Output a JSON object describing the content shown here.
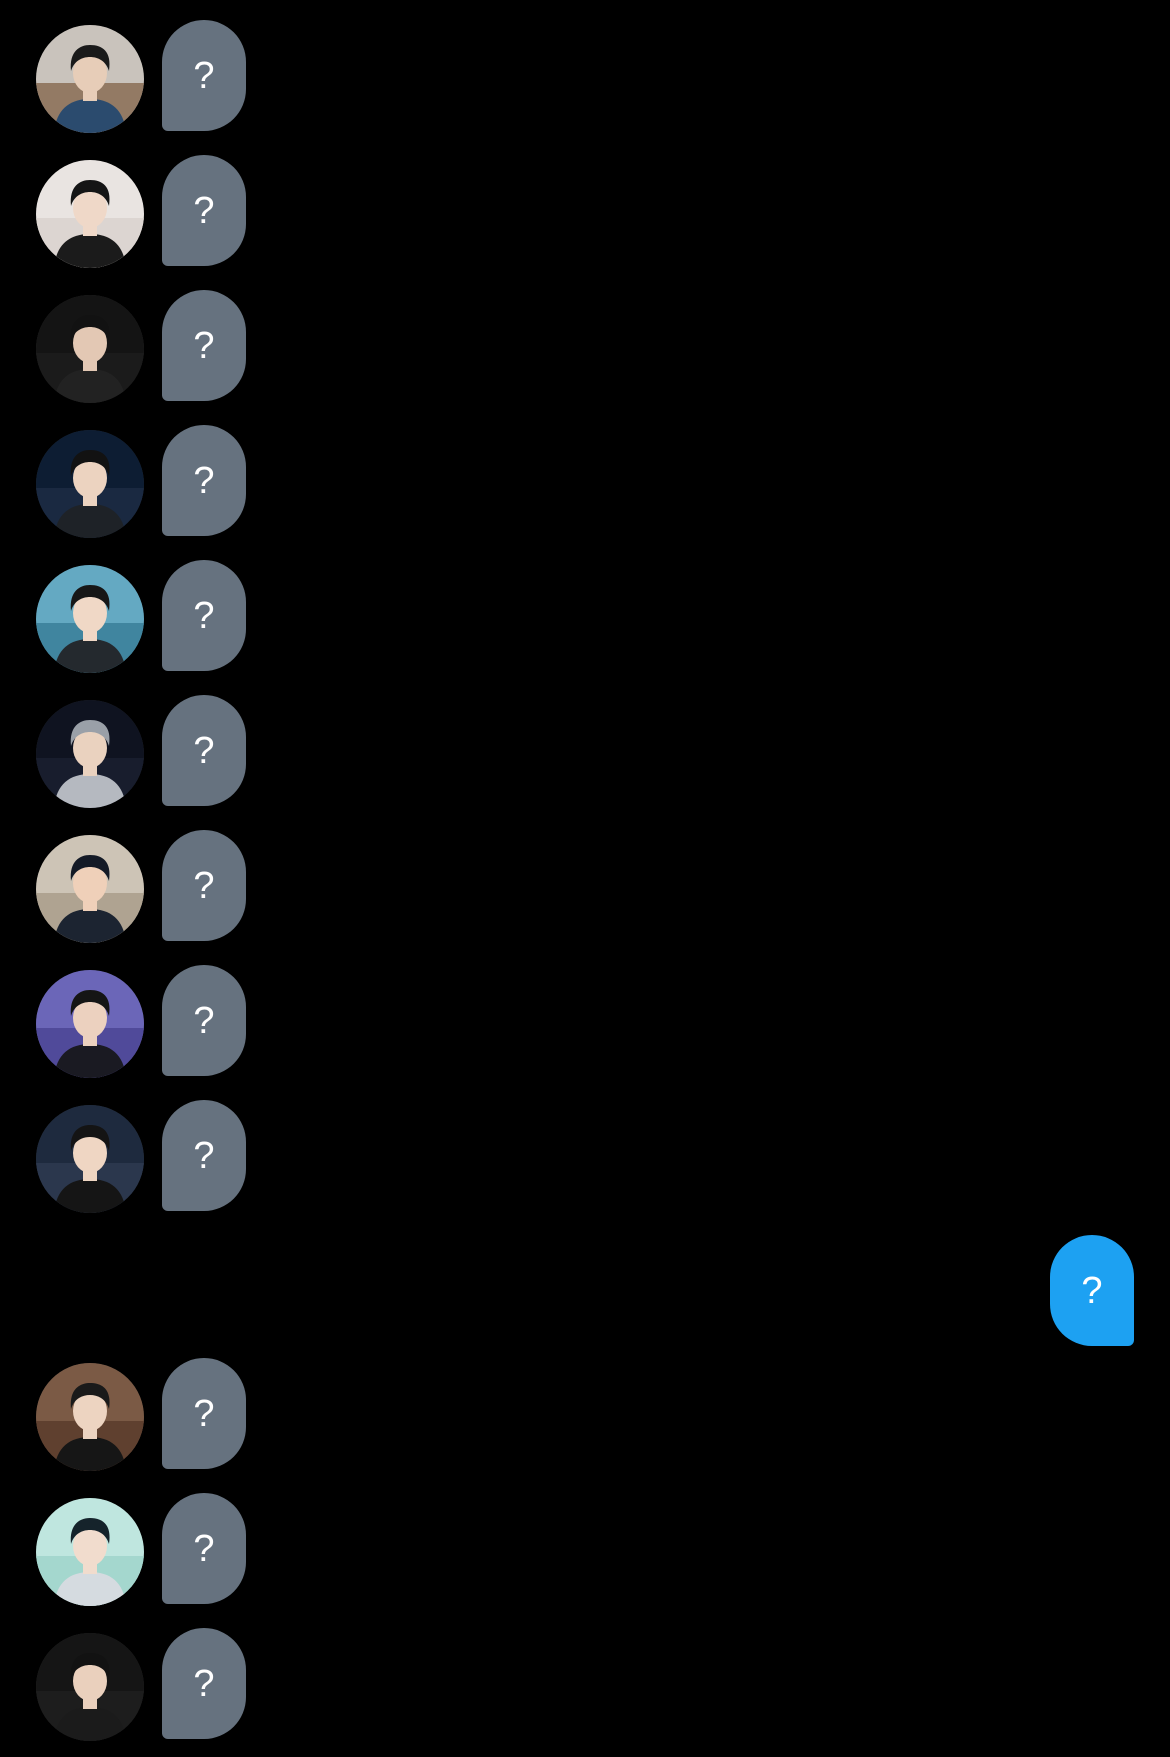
{
  "colors": {
    "background": "#000000",
    "incoming_bubble": "#66727f",
    "outgoing_bubble": "#1da1f2",
    "bubble_text": "#ffffff"
  },
  "messages": [
    {
      "direction": "incoming",
      "text": "?",
      "avatar": {
        "sky": "#c9c3bc",
        "bg": "#8a6d55",
        "shirt": "#2b4b6e",
        "hair": "#1a1a1a",
        "skin": "#e7cdb8"
      }
    },
    {
      "direction": "incoming",
      "text": "?",
      "avatar": {
        "sky": "#e9e4e1",
        "bg": "#d9d2ce",
        "shirt": "#1b1b1b",
        "hair": "#151515",
        "skin": "#efd8c8"
      }
    },
    {
      "direction": "incoming",
      "text": "?",
      "avatar": {
        "sky": "#141414",
        "bg": "#1c1c1c",
        "shirt": "#222222",
        "hair": "#121212",
        "skin": "#e3c8b4"
      }
    },
    {
      "direction": "incoming",
      "text": "?",
      "avatar": {
        "sky": "#0d1d33",
        "bg": "#1d2c44",
        "shirt": "#1e2227",
        "hair": "#121212",
        "skin": "#ecd3c0"
      }
    },
    {
      "direction": "incoming",
      "text": "?",
      "avatar": {
        "sky": "#64a9c2",
        "bg": "#3a7f99",
        "shirt": "#24292e",
        "hair": "#171717",
        "skin": "#f0d8c6"
      }
    },
    {
      "direction": "incoming",
      "text": "?",
      "avatar": {
        "sky": "#0f1320",
        "bg": "#1a2030",
        "shirt": "#b5b9c0",
        "hair": "#9aa0a8",
        "skin": "#ead2bf"
      }
    },
    {
      "direction": "incoming",
      "text": "?",
      "avatar": {
        "sky": "#cdc4b6",
        "bg": "#a99d8b",
        "shirt": "#1c2431",
        "hair": "#141a26",
        "skin": "#efd0b9"
      }
    },
    {
      "direction": "incoming",
      "text": "?",
      "avatar": {
        "sky": "#6b66b8",
        "bg": "#4b4594",
        "shirt": "#1a1a22",
        "hair": "#151515",
        "skin": "#ecd1bf"
      }
    },
    {
      "direction": "incoming",
      "text": "?",
      "avatar": {
        "sky": "#1e2a3e",
        "bg": "#2e3a50",
        "shirt": "#151515",
        "hair": "#141414",
        "skin": "#efd6c3"
      }
    },
    {
      "direction": "outgoing",
      "text": "?"
    },
    {
      "direction": "incoming",
      "text": "?",
      "avatar": {
        "sky": "#7b5a45",
        "bg": "#5a3c2c",
        "shirt": "#161616",
        "hair": "#1a1a1a",
        "skin": "#edd4c1"
      }
    },
    {
      "direction": "incoming",
      "text": "?",
      "avatar": {
        "sky": "#bfe6df",
        "bg": "#9fd4cb",
        "shirt": "#d5dbe0",
        "hair": "#15232b",
        "skin": "#f1dccd"
      }
    },
    {
      "direction": "incoming",
      "text": "?",
      "avatar": {
        "sky": "#151515",
        "bg": "#1f1f1f",
        "shirt": "#1b1b1b",
        "hair": "#121212",
        "skin": "#ead0bd"
      }
    }
  ]
}
